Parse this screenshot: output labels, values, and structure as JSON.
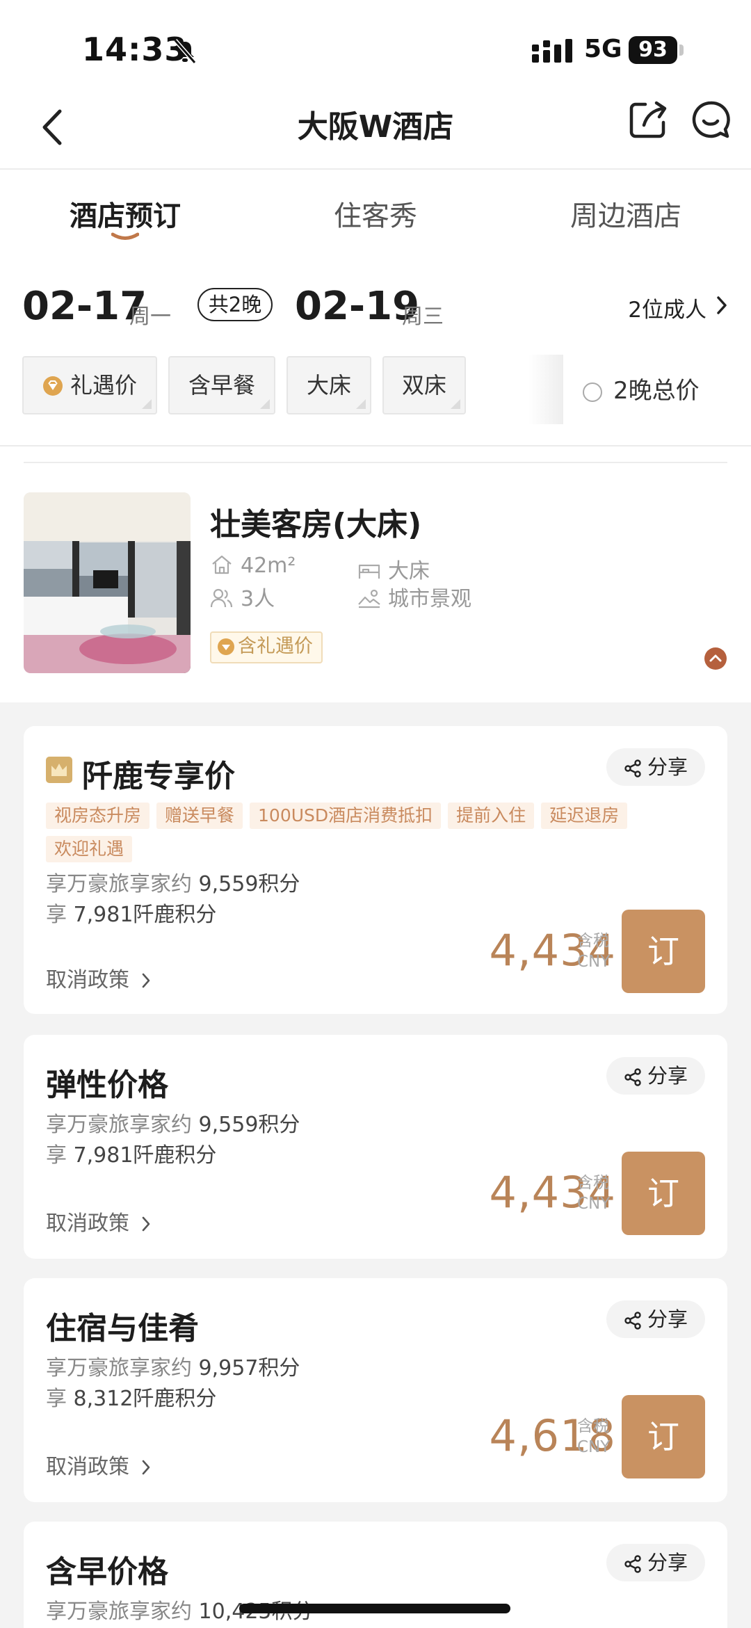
{
  "status_bar": {
    "time": "14:33",
    "network": "5G",
    "battery": "93"
  },
  "nav": {
    "title": "大阪W酒店"
  },
  "tabs": [
    {
      "label": "酒店预订",
      "active": true
    },
    {
      "label": "住客秀",
      "active": false
    },
    {
      "label": "周边酒店",
      "active": false
    }
  ],
  "stay": {
    "checkin_date": "02-17",
    "checkin_weekday": "周一",
    "nights": "共2晚",
    "checkout_date": "02-19",
    "checkout_weekday": "周三",
    "guests": "2位成人"
  },
  "filters": {
    "chips": [
      "礼遇价",
      "含早餐",
      "大床",
      "双床"
    ],
    "total_price_label": "2晚总价"
  },
  "room": {
    "name": "壮美客房(大床)",
    "area": "42m²",
    "bed": "大床",
    "occupancy": "3人",
    "view": "城市景观",
    "gift_tag": "含礼遇价"
  },
  "share_label": "分享",
  "cancel_label": "取消政策",
  "tax_label": "含税",
  "currency": "CNY",
  "book_label": "订",
  "rates": [
    {
      "title": "阡鹿专享价",
      "perks": [
        "视房态升房",
        "赠送早餐",
        "100USD酒店消费抵扣",
        "提前入住",
        "延迟退房",
        "欢迎礼遇"
      ],
      "points_line1_prefix": "享万豪旅享家约",
      "points_line1_value": "9,559积分",
      "points_line2_prefix": "享",
      "points_line2_value": "7,981阡鹿积分",
      "price": "4,434"
    },
    {
      "title": "弹性价格",
      "perks": [],
      "points_line1_prefix": "享万豪旅享家约",
      "points_line1_value": "9,559积分",
      "points_line2_prefix": "享",
      "points_line2_value": "7,981阡鹿积分",
      "price": "4,434"
    },
    {
      "title": "住宿与佳肴",
      "perks": [],
      "points_line1_prefix": "享万豪旅享家约",
      "points_line1_value": "9,957积分",
      "points_line2_prefix": "享",
      "points_line2_value": "8,312阡鹿积分",
      "price": "4,618"
    },
    {
      "title": "含早价格",
      "perks": [],
      "points_line1_prefix": "享万豪旅享家约",
      "points_line1_value": "10,425积分"
    }
  ],
  "colors": {
    "accent": "#c99262",
    "price": "#b98458",
    "perk_bg": "#fcf1e7"
  }
}
